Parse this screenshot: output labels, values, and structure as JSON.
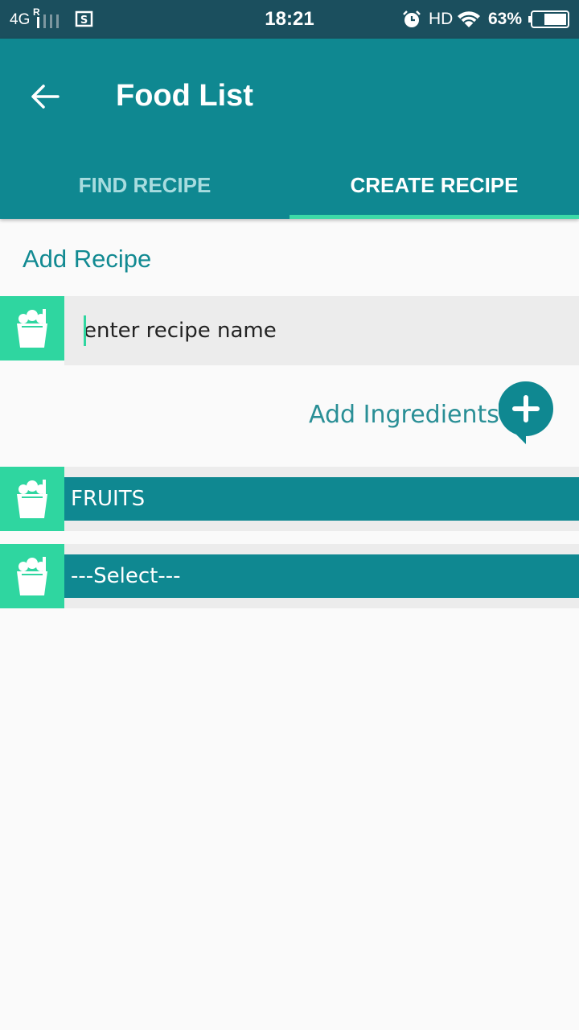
{
  "status_bar": {
    "network": "4G",
    "network_roaming": "R",
    "time": "18:21",
    "hd": "HD",
    "battery_percent": "63%"
  },
  "app_bar": {
    "title": "Food List",
    "tabs": [
      {
        "label": "FIND RECIPE",
        "selected": false
      },
      {
        "label": "CREATE RECIPE",
        "selected": true
      }
    ]
  },
  "form": {
    "section_title": "Add Recipe",
    "recipe_name_placeholder": "enter recipe name",
    "recipe_name_value": "",
    "add_ingredients_label": "Add Ingredients"
  },
  "dropdowns": [
    {
      "selected": "FRUITS"
    },
    {
      "selected": "---Select---"
    }
  ],
  "colors": {
    "primary": "#0f8891",
    "accent": "#2fd6a0",
    "status_bar": "#1b4f5e",
    "input_bg": "#ececec"
  },
  "icons": {
    "back": "arrow-left-icon",
    "food_bag": "grocery-bag-icon",
    "add": "plus-circle-icon"
  }
}
